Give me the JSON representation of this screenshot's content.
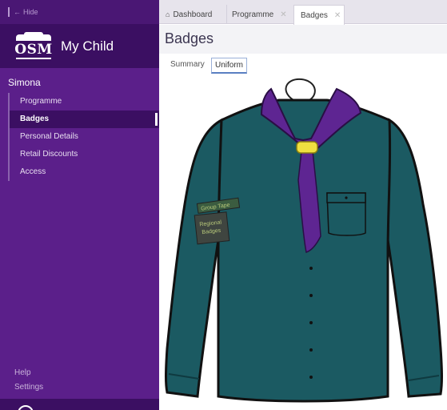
{
  "sidebar": {
    "hide_label": "Hide",
    "brand_logo_text": "OSM",
    "brand_name": "My Child",
    "child_name": "Simona",
    "nav_items": [
      {
        "label": "Programme",
        "active": false
      },
      {
        "label": "Badges",
        "active": true
      },
      {
        "label": "Personal Details",
        "active": false
      },
      {
        "label": "Retail Discounts",
        "active": false
      },
      {
        "label": "Access",
        "active": false
      }
    ],
    "help_label": "Help",
    "settings_label": "Settings"
  },
  "tabs": [
    {
      "label": "Dashboard",
      "icon": "home-icon",
      "closable": false
    },
    {
      "label": "Programme",
      "closable": true
    },
    {
      "label": "Badges",
      "closable": true,
      "active": true
    }
  ],
  "page": {
    "title": "Badges",
    "subtabs": [
      {
        "label": "Summary",
        "active": false
      },
      {
        "label": "Uniform",
        "active": true
      }
    ]
  },
  "uniform": {
    "badges": [
      {
        "label": "Group Tape"
      },
      {
        "label_line1": "Regional",
        "label_line2": "Badges"
      }
    ]
  },
  "colors": {
    "sidebar": "#5b1f8a",
    "shirt": "#1b5a62",
    "scarf": "#5e2592",
    "woggle": "#f0e040"
  }
}
